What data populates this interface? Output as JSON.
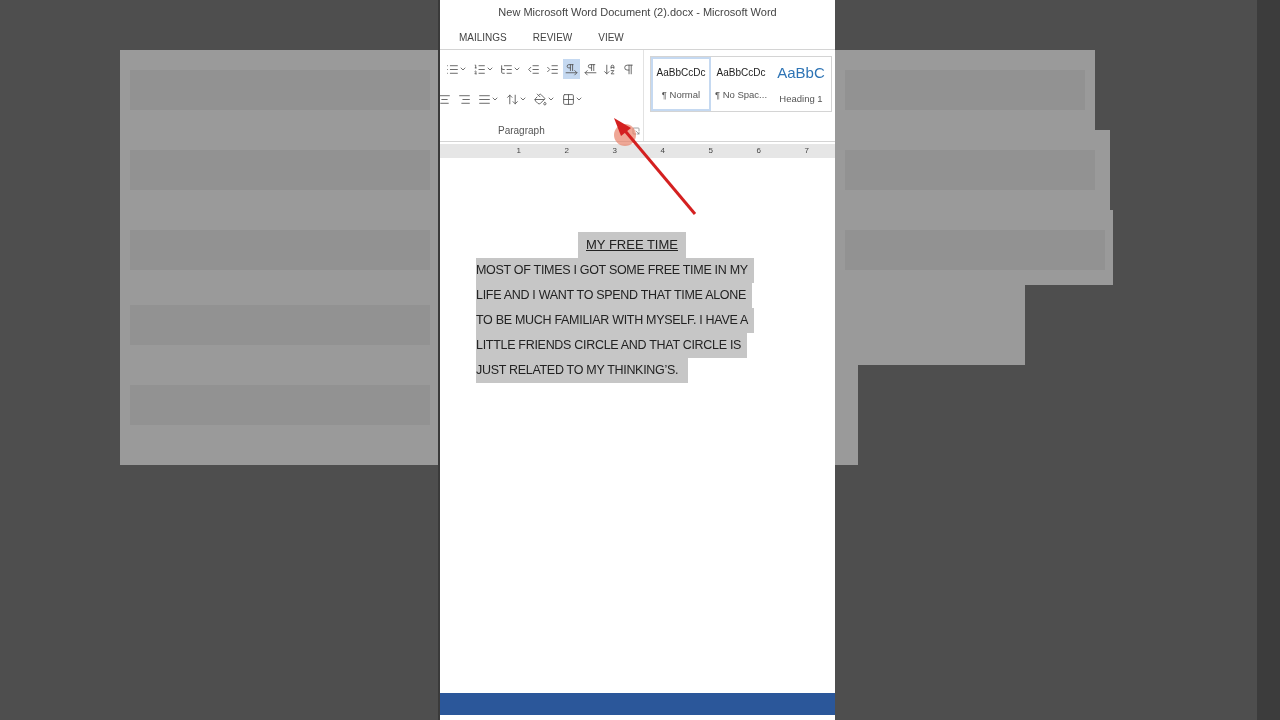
{
  "window": {
    "title": "New Microsoft Word Document (2).docx - Microsoft Word"
  },
  "tabs": [
    {
      "label": "MAILINGS",
      "selected": false
    },
    {
      "label": "REVIEW",
      "selected": false
    },
    {
      "label": "VIEW",
      "selected": false
    }
  ],
  "paragraph_group": {
    "label": "Paragraph",
    "row_1": [
      {
        "kind": "bullets",
        "selected": false
      },
      {
        "kind": "numbering",
        "selected": false
      },
      {
        "kind": "multilevel",
        "selected": false
      },
      {
        "kind": "decrease_indent",
        "selected": false
      },
      {
        "kind": "increase_indent",
        "selected": false
      },
      {
        "kind": "left_to_right",
        "selected": true
      },
      {
        "kind": "right_to_left",
        "selected": false
      },
      {
        "kind": "sort",
        "selected": false
      },
      {
        "kind": "show_marks",
        "selected": false
      }
    ],
    "row_2": [
      {
        "kind": "align_center",
        "selected": false
      },
      {
        "kind": "align_right",
        "selected": false
      },
      {
        "kind": "justify",
        "selected": false
      },
      {
        "kind": "line_spacing",
        "selected": false
      },
      {
        "kind": "shading",
        "selected": false
      },
      {
        "kind": "borders",
        "selected": false
      }
    ]
  },
  "styles": [
    {
      "preview": "AaBbCcDc",
      "name": "¶ Normal",
      "kind": "body",
      "selected": true
    },
    {
      "preview": "AaBbCcDc",
      "name": "¶ No Spac...",
      "kind": "body",
      "selected": false
    },
    {
      "preview": "AaBbC",
      "name": "Heading 1",
      "kind": "heading",
      "selected": false
    }
  ],
  "ruler": {
    "numbers": [
      "1",
      "2",
      "3",
      "4",
      "5",
      "6",
      "7"
    ]
  },
  "document": {
    "title": "MY FREE TIME",
    "highlighted": true,
    "lines": [
      "MOST OF TIMES I GOT SOME FREE TIME IN MY",
      "LIFE AND I WANT TO SPEND THAT TIME ALONE",
      "TO BE MUCH FAMILIAR WITH MYSELF. I HAVE A",
      "LITTLE FRIENDS CIRCLE AND THAT CIRCLE IS",
      "JUST RELATED TO MY THINKING’S."
    ]
  }
}
